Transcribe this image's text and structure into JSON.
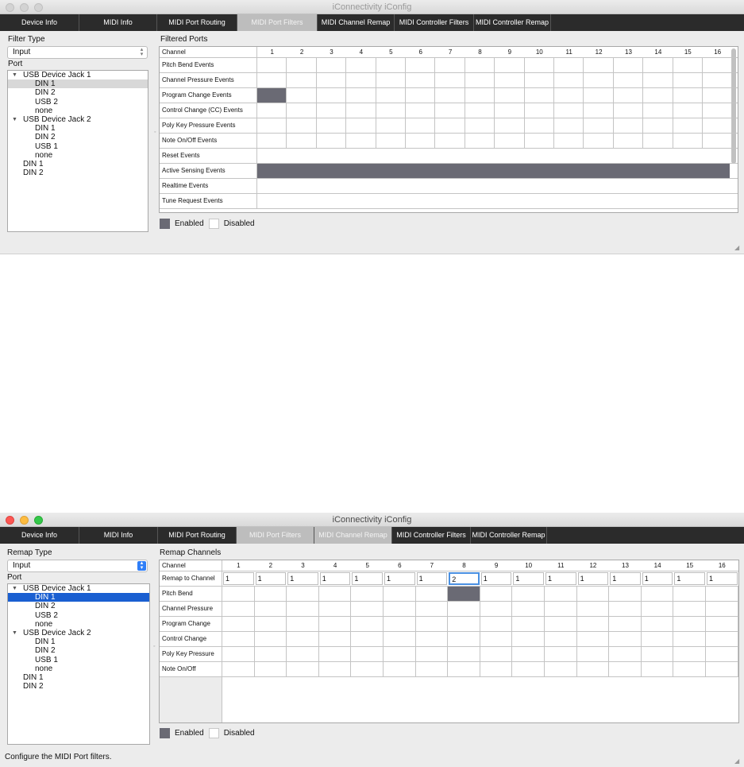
{
  "app_title": "iConnectivity iConfig",
  "tabs": [
    {
      "label": "Device Info"
    },
    {
      "label": "MIDI Info"
    },
    {
      "label": "MIDI Port Routing"
    },
    {
      "label": "MIDI Port Filters"
    },
    {
      "label": "MIDI Channel Remap"
    },
    {
      "label": "MIDI Controller Filters"
    },
    {
      "label": "MIDI Controller Remap"
    }
  ],
  "port_tree": [
    {
      "label": "USB Device Jack 1",
      "level": 0,
      "expand": true
    },
    {
      "label": "DIN 1",
      "level": 1
    },
    {
      "label": "DIN 2",
      "level": 1
    },
    {
      "label": "USB 2",
      "level": 1
    },
    {
      "label": "none",
      "level": 1
    },
    {
      "label": "USB Device Jack 2",
      "level": 0,
      "expand": true
    },
    {
      "label": "DIN 1",
      "level": 1
    },
    {
      "label": "DIN 2",
      "level": 1
    },
    {
      "label": "USB 1",
      "level": 1
    },
    {
      "label": "none",
      "level": 1
    },
    {
      "label": "DIN 1",
      "level": 0
    },
    {
      "label": "DIN 2",
      "level": 0
    }
  ],
  "port_tree_2": [
    {
      "label": "USB Device Jack 1",
      "level": 0,
      "expand": true
    },
    {
      "label": "DIN 1",
      "level": 1
    },
    {
      "label": "DIN 2",
      "level": 1
    },
    {
      "label": "USB 2",
      "level": 1
    },
    {
      "label": "none",
      "level": 1
    },
    {
      "label": "USB Device Jack 2",
      "level": 0,
      "expand": true
    },
    {
      "label": "DIN 1",
      "level": 1
    },
    {
      "label": "DIN 2",
      "level": 1
    },
    {
      "label": "USB 1",
      "level": 1
    },
    {
      "label": "none",
      "level": 1
    },
    {
      "label": "DIN 1",
      "level": 0
    },
    {
      "label": "DIN 2",
      "level": 0
    }
  ],
  "filters_window": {
    "filter_type_label": "Filter Type",
    "filter_type_value": "Input",
    "port_label": "Port",
    "selected_port_index": 1,
    "grid_title": "Filtered Ports",
    "channel_header": "Channel",
    "channels": [
      "1",
      "2",
      "3",
      "4",
      "5",
      "6",
      "7",
      "8",
      "9",
      "10",
      "11",
      "12",
      "13",
      "14",
      "15",
      "16"
    ],
    "per_channel_rows": [
      {
        "label": "Pitch Bend Events",
        "enabled": []
      },
      {
        "label": "Channel Pressure Events",
        "enabled": []
      },
      {
        "label": "Program Change Events",
        "enabled": [
          1
        ]
      },
      {
        "label": "Control Change (CC) Events",
        "enabled": []
      },
      {
        "label": "Poly Key Pressure Events",
        "enabled": []
      },
      {
        "label": "Note On/Off Events",
        "enabled": []
      }
    ],
    "system_rows": [
      {
        "label": "Reset Events",
        "enabled": false
      },
      {
        "label": "Active Sensing Events",
        "enabled": true
      },
      {
        "label": "Realtime Events",
        "enabled": false
      },
      {
        "label": "Tune Request Events",
        "enabled": false
      }
    ],
    "legend_enabled": "Enabled",
    "legend_disabled": "Disabled"
  },
  "remap_window": {
    "remap_type_label": "Remap Type",
    "remap_type_value": "Input",
    "port_label": "Port",
    "selected_port_index": 1,
    "grid_title": "Remap Channels",
    "channel_header": "Channel",
    "channels": [
      "1",
      "2",
      "3",
      "4",
      "5",
      "6",
      "7",
      "8",
      "9",
      "10",
      "11",
      "12",
      "13",
      "14",
      "15",
      "16"
    ],
    "remap_row_label": "Remap to Channel",
    "remap_values": [
      "1",
      "1",
      "1",
      "1",
      "1",
      "1",
      "1",
      "2",
      "1",
      "1",
      "1",
      "1",
      "1",
      "1",
      "1",
      "1"
    ],
    "focused_channel_index": 7,
    "rows": [
      {
        "label": "Pitch Bend",
        "enabled": [
          8
        ]
      },
      {
        "label": "Channel Pressure",
        "enabled": []
      },
      {
        "label": "Program Change",
        "enabled": []
      },
      {
        "label": "Control Change",
        "enabled": []
      },
      {
        "label": "Poly Key Pressure",
        "enabled": []
      },
      {
        "label": "Note On/Off",
        "enabled": []
      }
    ],
    "legend_enabled": "Enabled",
    "legend_disabled": "Disabled"
  },
  "status_text": "Configure the MIDI Port filters.",
  "colors": {
    "enabled_cell": "#6a6a74",
    "tab_bar": "#2b2b2b",
    "active_tab": "#bdbdbd",
    "selection_blue": "#1a5fd1"
  }
}
